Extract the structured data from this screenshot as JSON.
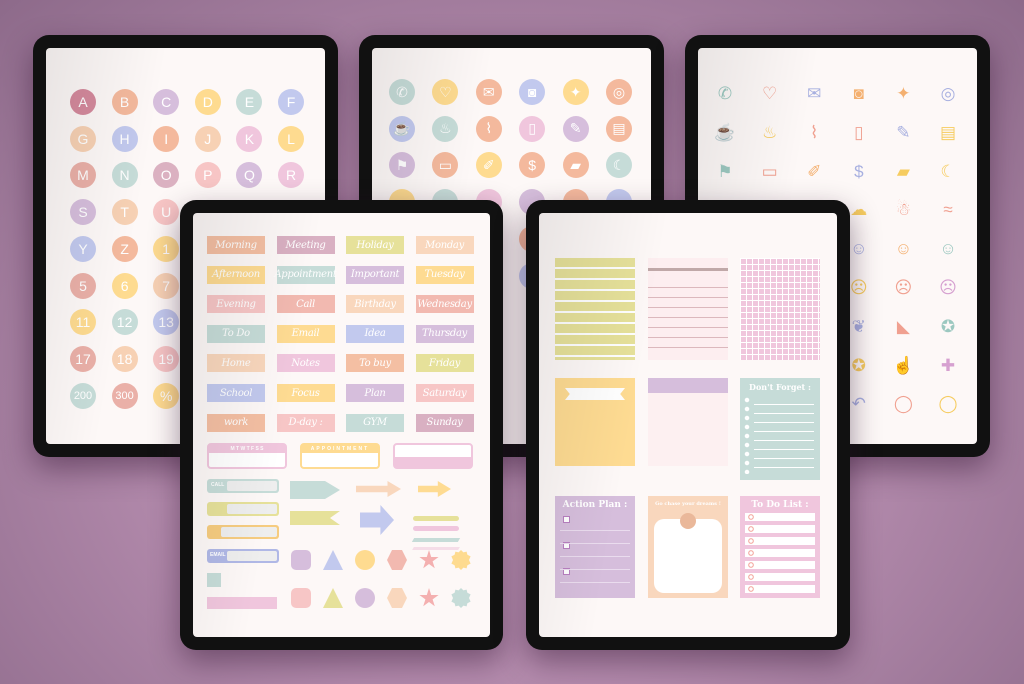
{
  "letters": [
    {
      "t": "A",
      "c": "#d58a9d"
    },
    {
      "t": "B",
      "c": "#f4b99d"
    },
    {
      "t": "C",
      "c": "#d6bedc"
    },
    {
      "t": "D",
      "c": "#fedb90"
    },
    {
      "t": "E",
      "c": "#c6dcd8"
    },
    {
      "t": "F",
      "c": "#c2c9ee"
    },
    {
      "t": "G",
      "c": "#f7d1b4"
    },
    {
      "t": "H",
      "c": "#c2c9ee"
    },
    {
      "t": "I",
      "c": "#f4b99d"
    },
    {
      "t": "J",
      "c": "#f7d1b4"
    },
    {
      "t": "K",
      "c": "#f0c6dd"
    },
    {
      "t": "L",
      "c": "#fedb90"
    },
    {
      "t": "M",
      "c": "#eab0a8"
    },
    {
      "t": "N",
      "c": "#c6dcd8"
    },
    {
      "t": "O",
      "c": "#dbb1c1"
    },
    {
      "t": "P",
      "c": "#f7c5c5"
    },
    {
      "t": "Q",
      "c": "#d6bedc"
    },
    {
      "t": "R",
      "c": "#f0c6dd"
    },
    {
      "t": "S",
      "c": "#d6bedc"
    },
    {
      "t": "T",
      "c": "#f7d1b4"
    },
    {
      "t": "U",
      "c": "#f7c5c5"
    },
    {
      "t": "Y",
      "c": "#c2c9ee"
    },
    {
      "t": "Z",
      "c": "#f4b99d"
    },
    {
      "t": "1",
      "c": "#fedb90"
    },
    {
      "t": "5",
      "c": "#eab0a8"
    },
    {
      "t": "6",
      "c": "#fedb90"
    },
    {
      "t": "7",
      "c": "#f7d1b4"
    },
    {
      "t": "11",
      "c": "#fedb90"
    },
    {
      "t": "12",
      "c": "#c6dcd8"
    },
    {
      "t": "13",
      "c": "#c2c9ee"
    },
    {
      "t": "17",
      "c": "#eab0a8"
    },
    {
      "t": "18",
      "c": "#f7d1b4"
    },
    {
      "t": "19",
      "c": "#f7c5c5"
    },
    {
      "t": "200",
      "c": "#c6dcd8"
    },
    {
      "t": "300",
      "c": "#eab0a8"
    },
    {
      "t": "%",
      "c": "#fedb90"
    }
  ],
  "color_icons": [
    {
      "n": "phone-icon",
      "g": "✆",
      "c": "#c6dcd8"
    },
    {
      "n": "heart-icon",
      "g": "♡",
      "c": "#fedb90"
    },
    {
      "n": "mail-icon",
      "g": "✉",
      "c": "#f4b99d"
    },
    {
      "n": "camera-icon",
      "g": "◙",
      "c": "#c2c9ee"
    },
    {
      "n": "bulb-icon",
      "g": "✦",
      "c": "#fedb90"
    },
    {
      "n": "instagram-icon",
      "g": "◎",
      "c": "#f4b99d"
    },
    {
      "n": "cup-icon",
      "g": "☕",
      "c": "#c2c9ee"
    },
    {
      "n": "beer-icon",
      "g": "♨",
      "c": "#c6dcd8"
    },
    {
      "n": "paperclip-icon",
      "g": "⌇",
      "c": "#f4b99d"
    },
    {
      "n": "phone-mobile-icon",
      "g": "▯",
      "c": "#f0c6dd"
    },
    {
      "n": "pencil-icon",
      "g": "✎",
      "c": "#d6bedc"
    },
    {
      "n": "notebook-icon",
      "g": "▤",
      "c": "#f4b99d"
    },
    {
      "n": "flag-icon",
      "g": "⚑",
      "c": "#d6bedc"
    },
    {
      "n": "laptop-icon",
      "g": "▭",
      "c": "#f4b99d"
    },
    {
      "n": "pen-icon",
      "g": "✐",
      "c": "#fedb90"
    },
    {
      "n": "dollar-icon",
      "g": "$",
      "c": "#f4b99d"
    },
    {
      "n": "bandage-icon",
      "g": "▰",
      "c": "#f4b99d"
    },
    {
      "n": "moon-icon",
      "g": "☾",
      "c": "#c6dcd8"
    }
  ],
  "outline_icons": [
    {
      "n": "phone-icon",
      "g": "✆",
      "c": "#9cc8c0"
    },
    {
      "n": "heart-icon",
      "g": "♡",
      "c": "#f0a090"
    },
    {
      "n": "mail-icon",
      "g": "✉",
      "c": "#a8b0e0"
    },
    {
      "n": "camera-icon",
      "g": "◙",
      "c": "#f4b070"
    },
    {
      "n": "bulb-icon",
      "g": "✦",
      "c": "#f4b070"
    },
    {
      "n": "instagram-icon",
      "g": "◎",
      "c": "#a8b0e0"
    },
    {
      "n": "cup-icon",
      "g": "☕",
      "c": "#f0a090"
    },
    {
      "n": "beer-icon",
      "g": "♨",
      "c": "#f6cc60"
    },
    {
      "n": "paperclip-icon",
      "g": "⌇",
      "c": "#f0a090"
    },
    {
      "n": "phone-mobile-icon",
      "g": "▯",
      "c": "#f0a090"
    },
    {
      "n": "pencil-icon",
      "g": "✎",
      "c": "#a8b0e0"
    },
    {
      "n": "notebook-icon",
      "g": "▤",
      "c": "#f6cc60"
    },
    {
      "n": "flag-icon",
      "g": "⚑",
      "c": "#9cc8c0"
    },
    {
      "n": "laptop-icon",
      "g": "▭",
      "c": "#f0a090"
    },
    {
      "n": "pen-icon",
      "g": "✐",
      "c": "#f4b070"
    },
    {
      "n": "dollar-icon",
      "g": "$",
      "c": "#a8b0e0"
    },
    {
      "n": "bandage-icon",
      "g": "▰",
      "c": "#f6cc60"
    },
    {
      "n": "moon-icon",
      "g": "☾",
      "c": "#f6cc60"
    },
    {
      "n": "sun-cloud-icon",
      "g": "☁",
      "c": "#f6cc60"
    },
    {
      "n": "snow-cloud-icon",
      "g": "☃",
      "c": "#f0a090"
    },
    {
      "n": "bacon-icon",
      "g": "≈",
      "c": "#f0a090"
    },
    {
      "n": "laugh-face-icon",
      "g": "☺",
      "c": "#a8b0e0"
    },
    {
      "n": "grin-face-icon",
      "g": "☺",
      "c": "#f4b070"
    },
    {
      "n": "smile-face-icon",
      "g": "☺",
      "c": "#9cc8c0"
    },
    {
      "n": "sad-face-icon",
      "g": "☹",
      "c": "#f6cc60"
    },
    {
      "n": "angry-face-icon",
      "g": "☹",
      "c": "#f0a090"
    },
    {
      "n": "dizzy-face-icon",
      "g": "☹",
      "c": "#d6a0d0"
    },
    {
      "n": "muscle-icon",
      "g": "❦",
      "c": "#a8b0e0"
    },
    {
      "n": "shoe-icon",
      "g": "◣",
      "c": "#f0a090"
    },
    {
      "n": "medal-icon",
      "g": "✪",
      "c": "#9cc8c0"
    },
    {
      "n": "award-icon",
      "g": "✪",
      "c": "#f6cc60"
    },
    {
      "n": "thumbs-up-icon",
      "g": "☝",
      "c": "#a8b0e0"
    },
    {
      "n": "pin-icon",
      "g": "✚",
      "c": "#d6a0d0"
    },
    {
      "n": "undo-icon",
      "g": "↶",
      "c": "#a8b0e0"
    },
    {
      "n": "speech-bubble-icon",
      "g": "◯",
      "c": "#f0a090"
    },
    {
      "n": "chat-bubble-icon",
      "g": "◯",
      "c": "#f6cc60"
    }
  ],
  "labels": [
    {
      "t": "Morning",
      "c": "#f4bfa3"
    },
    {
      "t": "Meeting",
      "c": "#d9b0c2"
    },
    {
      "t": "Holiday",
      "c": "#e6e19a"
    },
    {
      "t": "Monday",
      "c": "#f9d7bd"
    },
    {
      "t": "Afternoon",
      "c": "#fedb92"
    },
    {
      "t": "Appointment",
      "c": "#c6dcd8"
    },
    {
      "t": "Important",
      "c": "#d6bedc"
    },
    {
      "t": "Tuesday",
      "c": "#fedb92"
    },
    {
      "t": "Evening",
      "c": "#f7c6c6"
    },
    {
      "t": "Call",
      "c": "#f2b9b0"
    },
    {
      "t": "Birthday",
      "c": "#f9d7bd"
    },
    {
      "t": "Wednesday",
      "c": "#f2b9b0"
    },
    {
      "t": "To Do",
      "c": "#c6dcd8"
    },
    {
      "t": "Email",
      "c": "#fedb92"
    },
    {
      "t": "Idea",
      "c": "#c2c9ee"
    },
    {
      "t": "Thursday",
      "c": "#d6bedc"
    },
    {
      "t": "Home",
      "c": "#f9d7bd"
    },
    {
      "t": "Notes",
      "c": "#f0c6dd"
    },
    {
      "t": "To buy",
      "c": "#f4bfa3"
    },
    {
      "t": "Friday",
      "c": "#e6e19a"
    },
    {
      "t": "School",
      "c": "#c2c9ee"
    },
    {
      "t": "Focus",
      "c": "#fedb92"
    },
    {
      "t": "Plan",
      "c": "#d6bedc"
    },
    {
      "t": "Saturday",
      "c": "#f7c6c6"
    },
    {
      "t": "work",
      "c": "#f4bfa3"
    },
    {
      "t": "D-day :",
      "c": "#f7c6c6"
    },
    {
      "t": "GYM",
      "c": "#c6dcd8"
    },
    {
      "t": "Sunday",
      "c": "#d9b0c2"
    }
  ],
  "weekdays": "M  T  W  T  F  S  S",
  "appointment": "APPOINTMENT",
  "call_tag": "CALL",
  "email_tag": "EMAIL",
  "notes": {
    "dont_forget": "Don't Forget :",
    "action_plan": "Action Plan :",
    "chase_dreams": "Go chase your dreams !",
    "todo_list": "To Do List :"
  }
}
